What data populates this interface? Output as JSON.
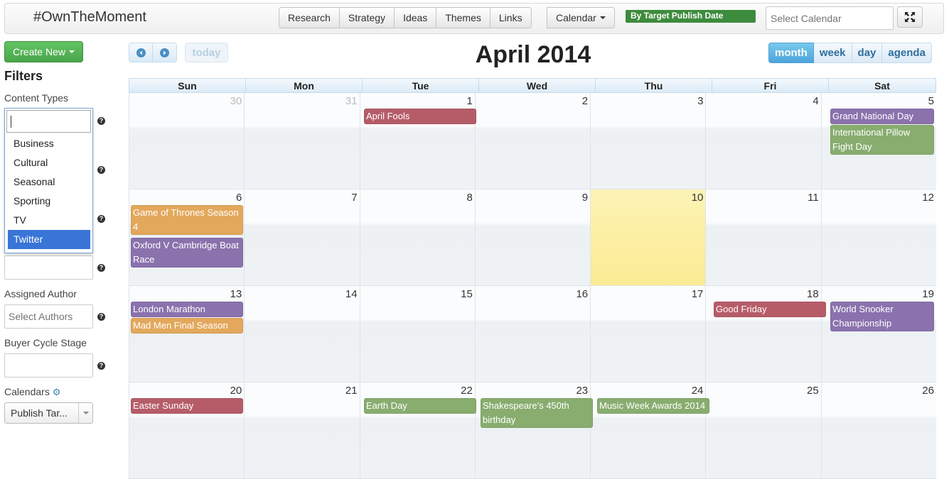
{
  "navbar": {
    "brand": "#OwnTheMoment",
    "main_tabs": [
      "Research",
      "Strategy",
      "Ideas",
      "Themes",
      "Links"
    ],
    "calendar_menu": "Calendar",
    "target_badge": "By Target Publish Date",
    "select_calendar_placeholder": "Select Calendar"
  },
  "sidebar": {
    "create_new": "Create New",
    "filters_title": "Filters",
    "content_types_label": "Content Types",
    "content_type_options": [
      "Business",
      "Cultural",
      "Seasonal",
      "Sporting",
      "TV",
      "Twitter"
    ],
    "content_type_selected": "Twitter",
    "assigned_author_label": "Assigned Author",
    "assigned_author_placeholder": "Select Authors",
    "buyer_cycle_label": "Buyer Cycle Stage",
    "calendars_label": "Calendars",
    "publish_select_value": "Publish Tar..."
  },
  "calendar": {
    "title": "April 2014",
    "today_label": "today",
    "views": [
      "month",
      "week",
      "day",
      "agenda"
    ],
    "active_view": "month",
    "weekdays": [
      "Sun",
      "Mon",
      "Tue",
      "Wed",
      "Thu",
      "Fri",
      "Sat"
    ],
    "weeks": [
      [
        "30",
        "31",
        "1",
        "2",
        "3",
        "4",
        "5"
      ],
      [
        "6",
        "7",
        "8",
        "9",
        "10",
        "11",
        "12"
      ],
      [
        "13",
        "14",
        "15",
        "16",
        "17",
        "18",
        "19"
      ],
      [
        "20",
        "21",
        "22",
        "23",
        "24",
        "25",
        "26"
      ]
    ],
    "other_month_days": [
      "30",
      "31"
    ],
    "today_date": "10",
    "colors": {
      "red": "#b65c69",
      "purple": "#8a72ad",
      "green": "#88ad6f",
      "orange": "#e3a85c"
    },
    "events": [
      {
        "title": "April Fools",
        "week": 0,
        "day": 2,
        "color": "red",
        "slot": 0,
        "lines": 1
      },
      {
        "title": "Grand National Day",
        "week": 0,
        "day": 6,
        "color": "purple",
        "slot": 0,
        "lines": 1
      },
      {
        "title": "International Pillow Fight Day",
        "week": 0,
        "day": 6,
        "color": "green",
        "slot": 1,
        "lines": 2
      },
      {
        "title": "Game of Thrones Season 4",
        "week": 1,
        "day": 0,
        "color": "orange",
        "slot": 0,
        "lines": 2
      },
      {
        "title": "Oxford V Cambridge Boat Race",
        "week": 1,
        "day": 0,
        "color": "purple",
        "slot": 2,
        "lines": 2
      },
      {
        "title": "London Marathon",
        "week": 2,
        "day": 0,
        "color": "purple",
        "slot": 0,
        "lines": 1
      },
      {
        "title": "Mad Men Final Season",
        "week": 2,
        "day": 0,
        "color": "orange",
        "slot": 1,
        "lines": 1
      },
      {
        "title": "Good Friday",
        "week": 2,
        "day": 5,
        "color": "red",
        "slot": 0,
        "lines": 1
      },
      {
        "title": "World Snooker Championship",
        "week": 2,
        "day": 6,
        "color": "purple",
        "slot": 0,
        "lines": 2
      },
      {
        "title": "Easter Sunday",
        "week": 3,
        "day": 0,
        "color": "red",
        "slot": 0,
        "lines": 1
      },
      {
        "title": "Earth Day",
        "week": 3,
        "day": 2,
        "color": "green",
        "slot": 0,
        "lines": 1
      },
      {
        "title": "Shakespeare's 450th birthday",
        "week": 3,
        "day": 3,
        "color": "green",
        "slot": 0,
        "lines": 2
      },
      {
        "title": "Music Week Awards 2014",
        "week": 3,
        "day": 4,
        "color": "green",
        "slot": 0,
        "lines": 1
      }
    ]
  }
}
